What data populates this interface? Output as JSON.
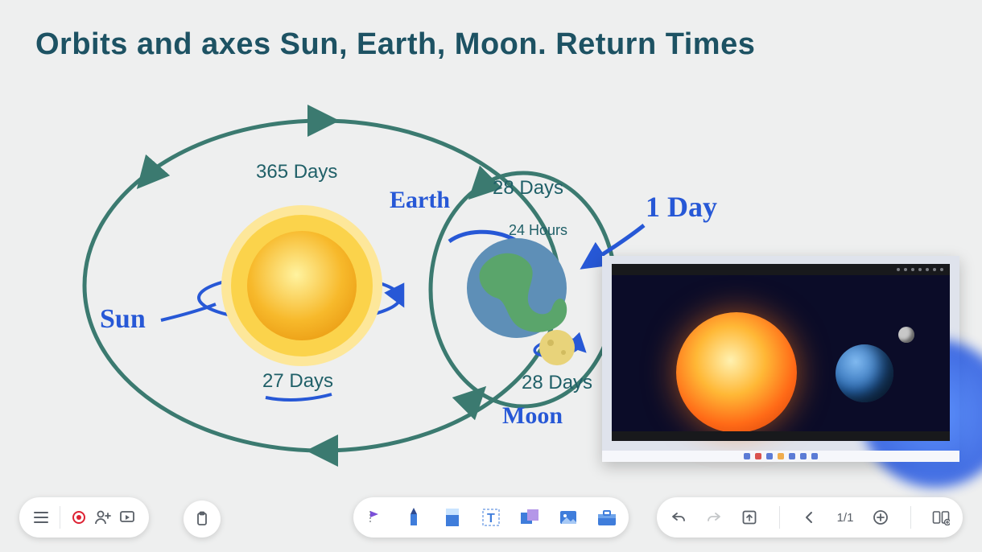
{
  "title": "Orbits and axes Sun, Earth, Moon. Return Times",
  "labels": {
    "days365": "365 Days",
    "days27": "27 Days",
    "days28top": "28 Days",
    "hours24": "24 Hours",
    "days28bottom": "28 Days"
  },
  "annotations": {
    "sun": "Sun",
    "earth": "Earth",
    "moon": "Moon",
    "oneday": "1 Day"
  },
  "toolbar": {
    "page": "1/1"
  }
}
